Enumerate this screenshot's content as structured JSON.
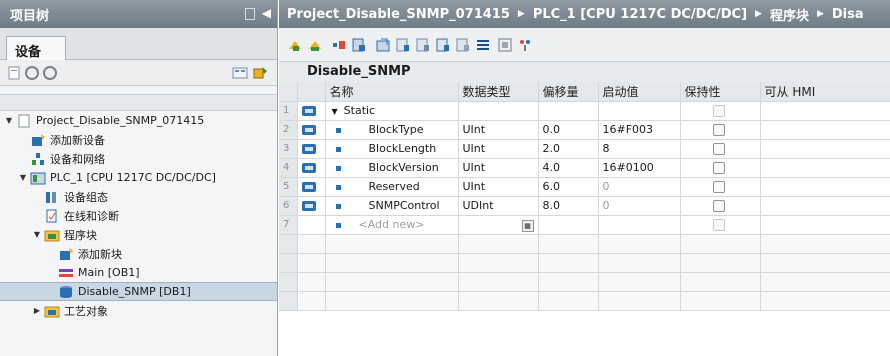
{
  "project_tree": {
    "title": "项目树",
    "tab_label": "设备",
    "items": [
      {
        "label": "Project_Disable_SNMP_071415",
        "indent": 0,
        "caret": "▼",
        "icon": "project-icon"
      },
      {
        "label": "添加新设备",
        "indent": 1,
        "caret": "",
        "icon": "add-device-icon"
      },
      {
        "label": "设备和网络",
        "indent": 1,
        "caret": "",
        "icon": "network-icon"
      },
      {
        "label": "PLC_1 [CPU 1217C DC/DC/DC]",
        "indent": 1,
        "caret": "▼",
        "icon": "plc-icon"
      },
      {
        "label": "设备组态",
        "indent": 2,
        "caret": "",
        "icon": "device-config-icon"
      },
      {
        "label": "在线和诊断",
        "indent": 2,
        "caret": "",
        "icon": "online-diagnostics-icon"
      },
      {
        "label": "程序块",
        "indent": 2,
        "caret": "▼",
        "icon": "program-blocks-folder-icon"
      },
      {
        "label": "添加新块",
        "indent": 3,
        "caret": "",
        "icon": "add-block-icon"
      },
      {
        "label": "Main [OB1]",
        "indent": 3,
        "caret": "",
        "icon": "ob-block-icon"
      },
      {
        "label": "Disable_SNMP [DB1]",
        "indent": 3,
        "caret": "",
        "icon": "db-block-icon",
        "selected": true
      },
      {
        "label": "工艺对象",
        "indent": 2,
        "caret": "▶",
        "icon": "technology-objects-folder-icon"
      }
    ]
  },
  "breadcrumb": {
    "parts": [
      "Project_Disable_SNMP_071415",
      "PLC_1 [CPU 1217C DC/DC/DC]",
      "程序块",
      "Disa"
    ],
    "separator": "▶"
  },
  "editor": {
    "block_name": "Disable_SNMP",
    "columns": [
      "名称",
      "数据类型",
      "偏移量",
      "启动值",
      "保持性",
      "可从 HMI"
    ],
    "rows": [
      {
        "num": "1",
        "name": "Static",
        "type": "",
        "offset": "",
        "start": "",
        "retain": true,
        "kind": "section"
      },
      {
        "num": "2",
        "name": "BlockType",
        "type": "UInt",
        "offset": "0.0",
        "start": "16#F003",
        "retain": true,
        "kind": "member"
      },
      {
        "num": "3",
        "name": "BlockLength",
        "type": "UInt",
        "offset": "2.0",
        "start": "8",
        "retain": true,
        "kind": "member"
      },
      {
        "num": "4",
        "name": "BlockVersion",
        "type": "UInt",
        "offset": "4.0",
        "start": "16#0100",
        "retain": true,
        "kind": "member"
      },
      {
        "num": "5",
        "name": "Reserved",
        "type": "UInt",
        "offset": "6.0",
        "start": "0",
        "retain": true,
        "kind": "member"
      },
      {
        "num": "6",
        "name": "SNMPControl",
        "type": "UDInt",
        "offset": "8.0",
        "start": "0",
        "retain": true,
        "kind": "member"
      },
      {
        "num": "7",
        "name": "<Add new>",
        "type": "",
        "offset": "",
        "start": "",
        "retain": true,
        "kind": "add"
      }
    ]
  },
  "colors": {
    "title_bar": "#7c8790",
    "selected_row": "#c9d7e4",
    "icon_blue": "#2a6fb0",
    "grid_header": "#e4e8eb"
  }
}
